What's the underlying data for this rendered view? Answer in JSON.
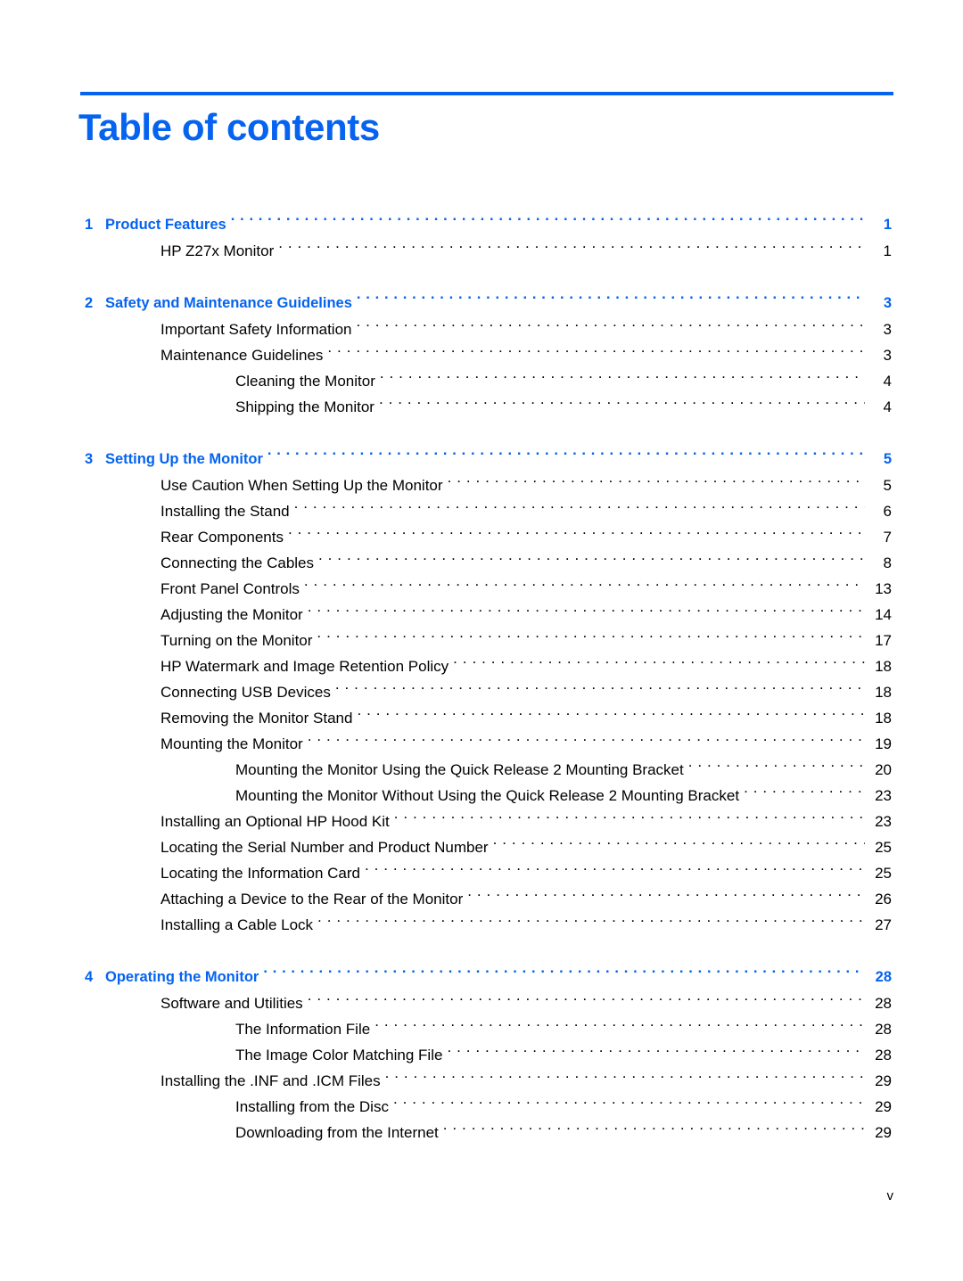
{
  "document": {
    "title": "Table of contents",
    "accent_color": "#0563f0",
    "text_color": "#000000",
    "footer_page_number": "v"
  },
  "toc": {
    "entries": [
      {
        "level": 0,
        "number": "1",
        "label": "Product Features",
        "page": "1"
      },
      {
        "level": 1,
        "number": "",
        "label": "HP Z27x Monitor",
        "page": "1"
      },
      {
        "level": 0,
        "number": "2",
        "label": "Safety and Maintenance Guidelines",
        "page": "3"
      },
      {
        "level": 1,
        "number": "",
        "label": "Important Safety Information",
        "page": "3"
      },
      {
        "level": 1,
        "number": "",
        "label": "Maintenance Guidelines",
        "page": "3"
      },
      {
        "level": 2,
        "number": "",
        "label": "Cleaning the Monitor",
        "page": "4"
      },
      {
        "level": 2,
        "number": "",
        "label": "Shipping the Monitor",
        "page": "4"
      },
      {
        "level": 0,
        "number": "3",
        "label": "Setting Up the Monitor",
        "page": "5"
      },
      {
        "level": 1,
        "number": "",
        "label": "Use Caution When Setting Up the Monitor",
        "page": "5"
      },
      {
        "level": 1,
        "number": "",
        "label": "Installing the Stand",
        "page": "6"
      },
      {
        "level": 1,
        "number": "",
        "label": "Rear Components",
        "page": "7"
      },
      {
        "level": 1,
        "number": "",
        "label": "Connecting the Cables",
        "page": "8"
      },
      {
        "level": 1,
        "number": "",
        "label": "Front Panel Controls",
        "page": "13"
      },
      {
        "level": 1,
        "number": "",
        "label": "Adjusting the Monitor",
        "page": "14"
      },
      {
        "level": 1,
        "number": "",
        "label": "Turning on the Monitor",
        "page": "17"
      },
      {
        "level": 1,
        "number": "",
        "label": "HP Watermark and Image Retention Policy",
        "page": "18"
      },
      {
        "level": 1,
        "number": "",
        "label": "Connecting USB Devices",
        "page": "18"
      },
      {
        "level": 1,
        "number": "",
        "label": "Removing the Monitor Stand",
        "page": "18"
      },
      {
        "level": 1,
        "number": "",
        "label": "Mounting the Monitor",
        "page": "19"
      },
      {
        "level": 2,
        "number": "",
        "label": "Mounting the Monitor Using the Quick Release 2 Mounting Bracket",
        "page": "20"
      },
      {
        "level": 2,
        "number": "",
        "label": "Mounting the Monitor Without Using the Quick Release 2 Mounting Bracket",
        "page": "23"
      },
      {
        "level": 1,
        "number": "",
        "label": "Installing an Optional HP Hood Kit",
        "page": "23"
      },
      {
        "level": 1,
        "number": "",
        "label": "Locating the Serial Number and Product Number",
        "page": "25"
      },
      {
        "level": 1,
        "number": "",
        "label": "Locating the Information Card",
        "page": "25"
      },
      {
        "level": 1,
        "number": "",
        "label": "Attaching a Device to the Rear of the Monitor",
        "page": "26"
      },
      {
        "level": 1,
        "number": "",
        "label": "Installing a Cable Lock",
        "page": "27"
      },
      {
        "level": 0,
        "number": "4",
        "label": "Operating the Monitor",
        "page": "28"
      },
      {
        "level": 1,
        "number": "",
        "label": "Software and Utilities",
        "page": "28"
      },
      {
        "level": 2,
        "number": "",
        "label": "The Information File",
        "page": "28"
      },
      {
        "level": 2,
        "number": "",
        "label": "The Image Color Matching File",
        "page": "28"
      },
      {
        "level": 1,
        "number": "",
        "label": "Installing the .INF and .ICM Files",
        "page": "29"
      },
      {
        "level": 2,
        "number": "",
        "label": "Installing from the Disc",
        "page": "29"
      },
      {
        "level": 2,
        "number": "",
        "label": "Downloading from the Internet",
        "page": "29"
      }
    ]
  }
}
